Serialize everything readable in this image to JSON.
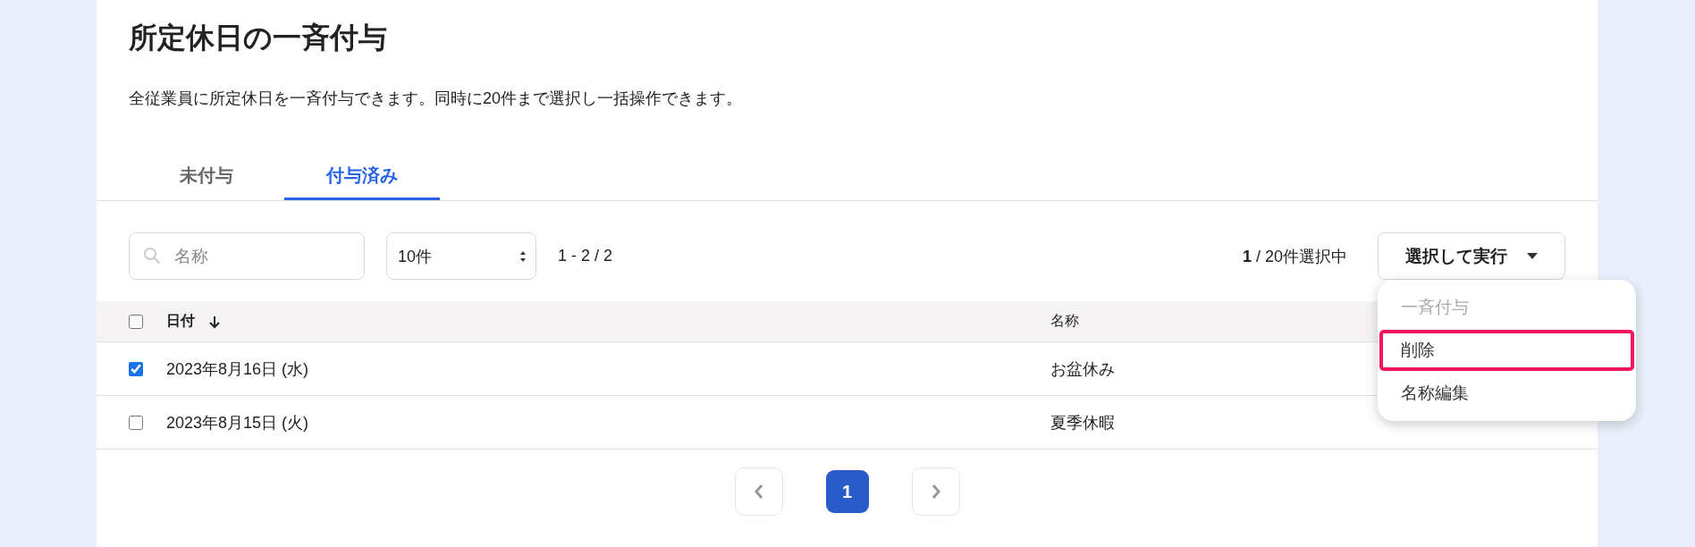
{
  "page": {
    "title": "所定休日の一斉付与",
    "description": "全従業員に所定休日を一斉付与できます。同時に20件まで選択し一括操作できます。"
  },
  "tabs": [
    {
      "label": "未付与",
      "selected": false
    },
    {
      "label": "付与済み",
      "selected": true
    }
  ],
  "toolbar": {
    "search": {
      "placeholder": "名称"
    },
    "page_size": {
      "value": "10件"
    },
    "range": "1 - 2 / 2",
    "selection_count": "1",
    "selection_limit": " / 20件選択中",
    "action_button": "選択して実行"
  },
  "action_menu": [
    {
      "label": "一斉付与",
      "disabled": true,
      "highlighted": false
    },
    {
      "label": "削除",
      "disabled": false,
      "highlighted": true
    },
    {
      "label": "名称編集",
      "disabled": false,
      "highlighted": false
    }
  ],
  "table": {
    "select_all": {
      "checked": false
    },
    "columns": [
      {
        "label": "日付",
        "sorted": true
      },
      {
        "label": "名称",
        "sorted": false
      }
    ],
    "rows": [
      {
        "checked": true,
        "date": "2023年8月16日 (水)",
        "name": "お盆休み"
      },
      {
        "checked": false,
        "date": "2023年8月15日 (火)",
        "name": "夏季休暇"
      }
    ]
  },
  "pagination": {
    "pages": [
      {
        "label": "1",
        "selected": true
      }
    ]
  }
}
